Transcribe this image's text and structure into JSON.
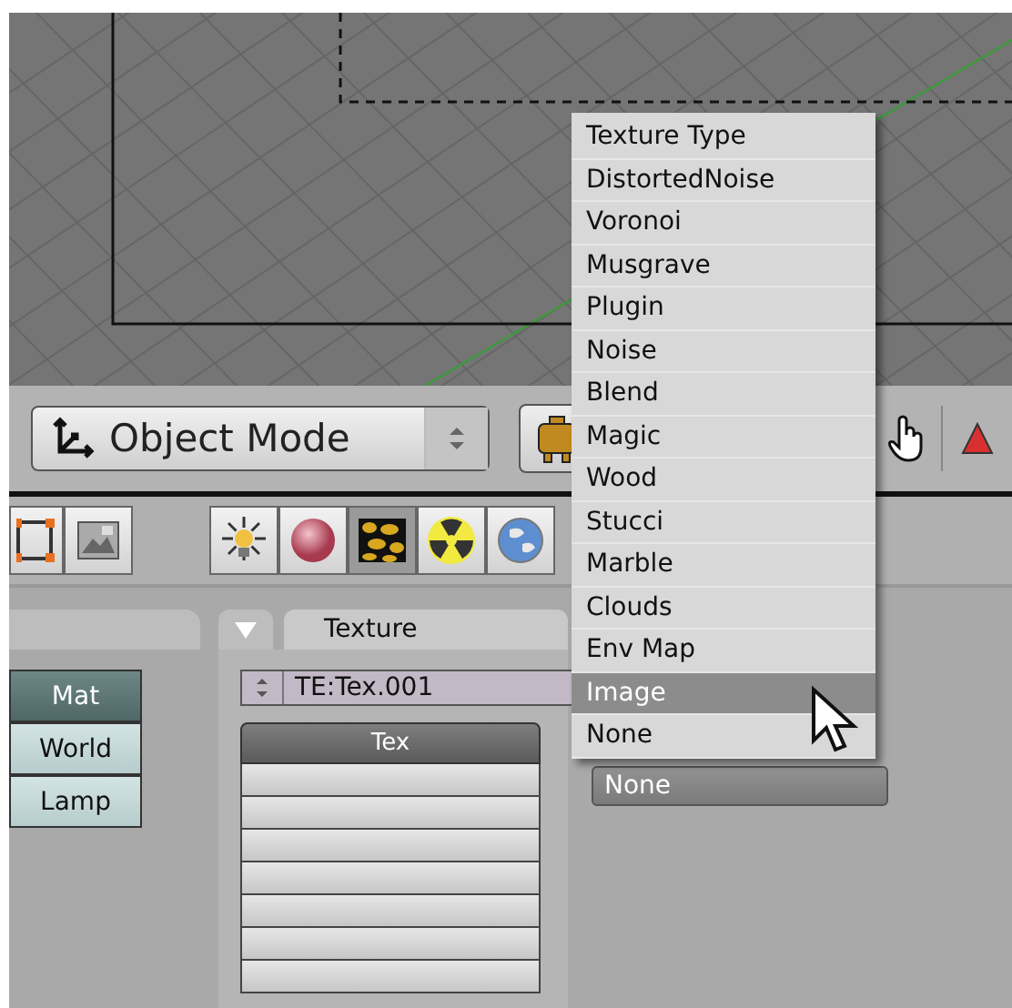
{
  "header": {
    "mode_dropdown": {
      "label": "Object Mode"
    }
  },
  "context_buttons": [
    {
      "kind": "lamp",
      "selected": false
    },
    {
      "kind": "material",
      "selected": false
    },
    {
      "kind": "texture",
      "selected": true
    },
    {
      "kind": "radiosity",
      "selected": false
    },
    {
      "kind": "world",
      "selected": false
    }
  ],
  "left_panel": {
    "tabs": [
      {
        "label": "Mat",
        "selected": true
      },
      {
        "label": "World",
        "selected": false
      },
      {
        "label": "Lamp",
        "selected": false
      }
    ]
  },
  "texture_panel": {
    "title": "Texture",
    "datablock": "TE:Tex.001",
    "channels_header": "Tex"
  },
  "type_dropdown": {
    "value": "None"
  },
  "popup_menu": {
    "title": "Texture Type",
    "items": [
      {
        "label": "DistortedNoise",
        "selected": false
      },
      {
        "label": "Voronoi",
        "selected": false
      },
      {
        "label": "Musgrave",
        "selected": false
      },
      {
        "label": "Plugin",
        "selected": false
      },
      {
        "label": "Noise",
        "selected": false
      },
      {
        "label": "Blend",
        "selected": false
      },
      {
        "label": "Magic",
        "selected": false
      },
      {
        "label": "Wood",
        "selected": false
      },
      {
        "label": "Stucci",
        "selected": false
      },
      {
        "label": "Marble",
        "selected": false
      },
      {
        "label": "Clouds",
        "selected": false
      },
      {
        "label": "Env Map",
        "selected": false
      },
      {
        "label": "Image",
        "selected": true
      },
      {
        "label": "None",
        "selected": false
      }
    ]
  }
}
